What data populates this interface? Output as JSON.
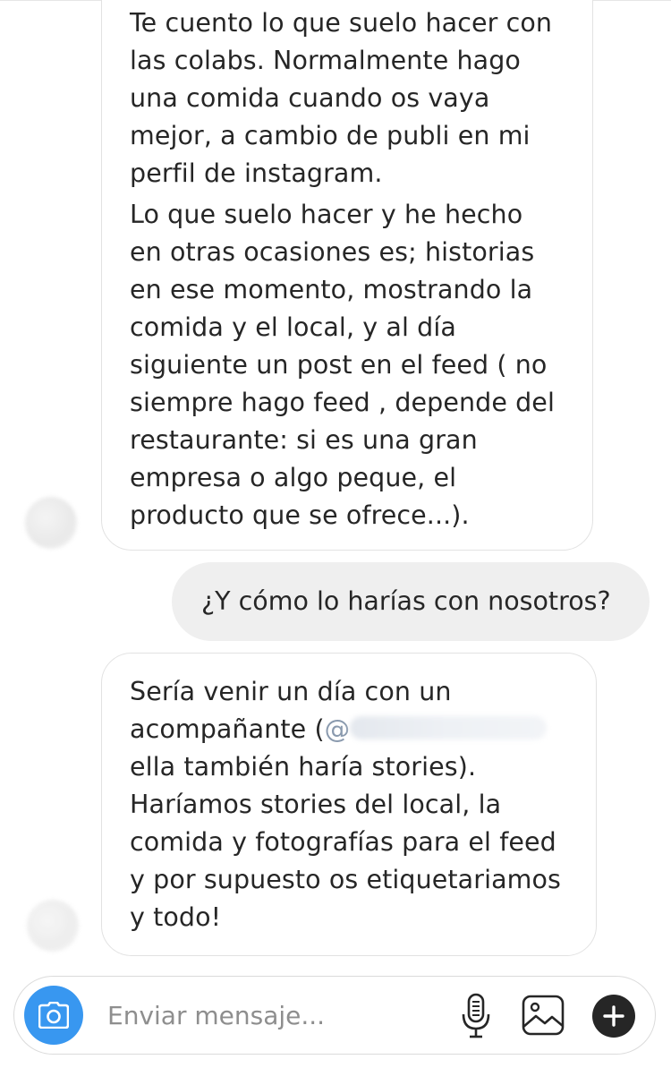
{
  "messages": [
    {
      "direction": "incoming",
      "paragraphs": [
        [
          "Te cuento lo que suelo hacer con",
          "las colabs. Normalmente hago",
          "una comida cuando os vaya",
          "mejor, a cambio de publi en mi",
          "perfil de instagram."
        ],
        [
          "Lo que suelo hacer y he hecho",
          "en otras ocasiones es;  historias",
          "en ese momento, mostrando la",
          "comida y el local, y al día",
          "siguiente un post en el feed ( no",
          "siempre hago feed , depende del",
          "restaurante: si es una gran",
          "empresa o algo peque, el",
          "producto que se ofrece...)."
        ]
      ]
    },
    {
      "direction": "outgoing",
      "text": "¿Y cómo lo harías con nosotros?"
    },
    {
      "direction": "incoming",
      "lines": [
        "Sería venir un día con un",
        "acompañante (",
        "ella también haría stories).",
        "Haríamos stories del local, la",
        "comida y fotografías para el feed",
        "y por supuesto os etiquetariamos",
        "y todo!"
      ],
      "mention_symbol": "@"
    }
  ],
  "composer": {
    "placeholder": "Enviar mensaje...",
    "camera_icon": "camera-icon",
    "mic_icon": "microphone-icon",
    "gallery_icon": "gallery-icon",
    "plus_icon": "plus-icon",
    "accent_color": "#3897f0"
  }
}
